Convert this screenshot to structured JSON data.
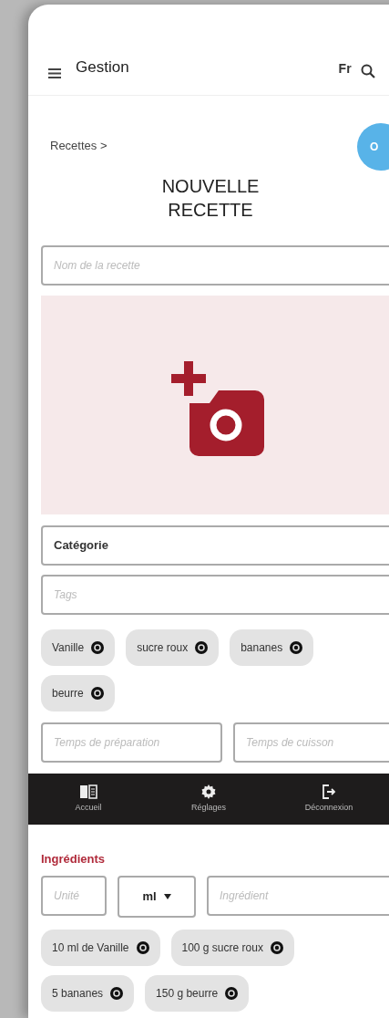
{
  "app_bar": {
    "title": "Gestion",
    "language": "Fr"
  },
  "breadcrumb": "Recettes >",
  "ok_button": "O",
  "title": "NOUVELLE RECETTE",
  "name_field": {
    "placeholder": "Nom de la recette"
  },
  "category": {
    "value": "Catégorie"
  },
  "tags_field": {
    "placeholder": "Tags"
  },
  "tags": [
    "Vanille",
    "sucre roux",
    "bananes",
    "beurre"
  ],
  "times": [
    {
      "placeholder": "Temps de préparation"
    },
    {
      "placeholder": "Temps de cuisson"
    }
  ],
  "bottom_nav": [
    {
      "kind": "book",
      "label": "Accueil"
    },
    {
      "kind": "gear",
      "label": "Réglages"
    },
    {
      "kind": "logout",
      "label": "Déconnexion"
    }
  ],
  "ingredients": {
    "heading": "Ingrédients",
    "quantity_placeholder": "Unité",
    "unit": "ml",
    "ingredient_placeholder": "Ingrédient",
    "items": [
      "10 ml de Vanille",
      "100 g sucre roux",
      "5 bananes",
      "150 g beurre"
    ]
  }
}
